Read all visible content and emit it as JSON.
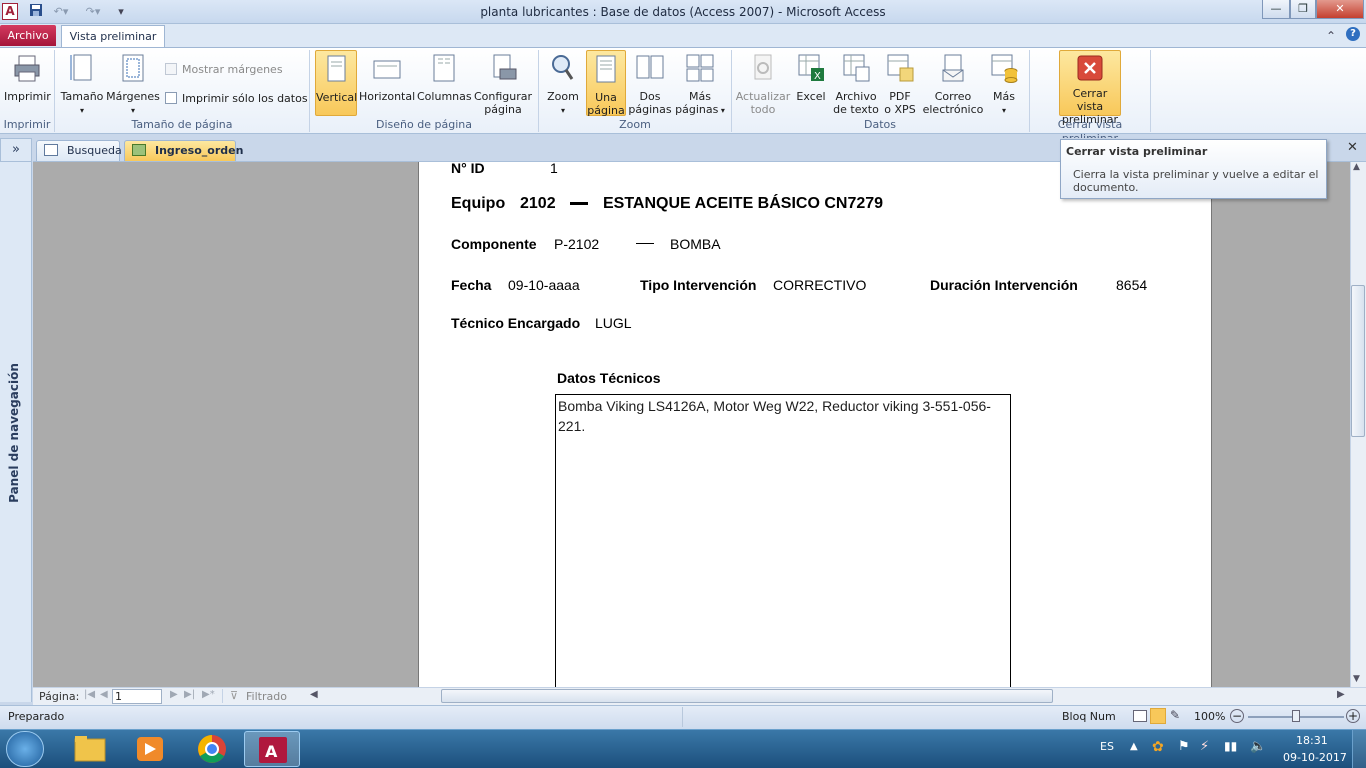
{
  "window": {
    "title": "planta lubricantes : Base de datos (Access 2007)  -  Microsoft Access",
    "app_icon_letter": "A",
    "controls": {
      "minimize": "—",
      "restore": "❐",
      "close": "✕"
    }
  },
  "ribbon_tabs": {
    "archivo": "Archivo",
    "vista": "Vista preliminar"
  },
  "ribbon": {
    "imprimir": {
      "label": "Imprimir",
      "group": "Imprimir"
    },
    "tamano_pagina": {
      "tamano": "Tamaño",
      "margenes": "Márgenes",
      "mostrar_margenes": "Mostrar márgenes",
      "imprimir_solo_datos": "Imprimir sólo los datos",
      "group": "Tamaño de página"
    },
    "diseno_pagina": {
      "vertical": "Vertical",
      "horizontal": "Horizontal",
      "columnas": "Columnas",
      "configurar_1": "Configurar",
      "configurar_2": "página",
      "group": "Diseño de página"
    },
    "zoom": {
      "zoom": "Zoom",
      "una_1": "Una",
      "una_2": "página",
      "dos_1": "Dos",
      "dos_2": "páginas",
      "mas_1": "Más",
      "mas_2": "páginas",
      "group": "Zoom"
    },
    "datos": {
      "actualizar_1": "Actualizar",
      "actualizar_2": "todo",
      "excel": "Excel",
      "archivo_1": "Archivo",
      "archivo_2": "de texto",
      "pdf_1": "PDF",
      "pdf_2": "o XPS",
      "correo_1": "Correo",
      "correo_2": "electrónico",
      "mas": "Más",
      "group": "Datos"
    },
    "cerrar": {
      "label_1": "Cerrar vista",
      "label_2": "preliminar",
      "group": "Cerrar vista preliminar"
    }
  },
  "tooltip": {
    "title": "Cerrar vista preliminar",
    "body": "Cierra la vista preliminar y vuelve a editar el documento."
  },
  "doc_tabs": [
    "Busqueda",
    "Ingreso_orden"
  ],
  "nav_pane": {
    "label": "Panel de navegación",
    "collapse": "»"
  },
  "report": {
    "id_label": "N° ID",
    "id_value": "1",
    "equipo_label": "Equipo",
    "equipo_code": "2102",
    "equipo_name": "ESTANQUE ACEITE BÁSICO CN7279",
    "componente_label": "Componente",
    "componente_code": "P-2102",
    "componente_name": "BOMBA",
    "fecha_label": "Fecha",
    "fecha_value": "09-10-aaaa",
    "tipo_label": "Tipo Intervención",
    "tipo_value": "CORRECTIVO",
    "duracion_label": "Duración Intervención",
    "duracion_value": "8654",
    "tecnico_label": "Técnico Encargado",
    "tecnico_value": "LUGL",
    "datos_label": "Datos Técnicos",
    "datos_value": "Bomba Viking LS4126A, Motor Weg W22, Reductor viking 3-551-056-221."
  },
  "page_nav": {
    "label": "Página:",
    "value": "1",
    "filter": "Filtrado"
  },
  "status": {
    "left": "Preparado",
    "bloq": "Bloq Num",
    "zoom": "100%"
  },
  "taskbar": {
    "lang": "ES",
    "time": "18:31",
    "date": "09-10-2017"
  },
  "colors": {
    "archivo_tab": "#b0183e",
    "selected": "#f8c85a",
    "close_btn": "#c4402f",
    "taskbar": "#1c4f7c"
  }
}
